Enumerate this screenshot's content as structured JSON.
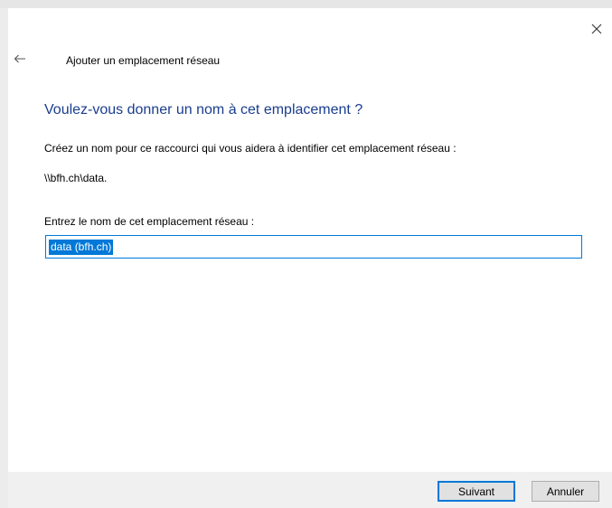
{
  "wizard": {
    "title": "Ajouter un emplacement réseau",
    "heading": "Voulez-vous donner un nom à cet emplacement ?",
    "description": "Créez un nom pour ce raccourci qui vous aidera à identifier cet emplacement réseau :",
    "network_path": "\\\\bfh.ch\\data.",
    "name_label": "Entrez le nom de cet emplacement réseau :",
    "name_value": "data (bfh.ch)"
  },
  "buttons": {
    "next_label": "Suivant",
    "cancel_label": "Annuler"
  },
  "icons": {
    "close": "close-icon",
    "back": "back-arrow-icon"
  },
  "colors": {
    "heading": "#1a3d8f",
    "accent": "#0078d7",
    "footer_bg": "#f0f0f0"
  }
}
